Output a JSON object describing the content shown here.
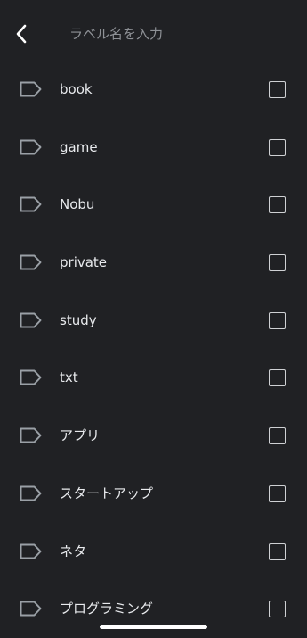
{
  "header": {
    "back_icon": "chevron-left-icon",
    "search_placeholder": "ラベル名を入力",
    "search_value": ""
  },
  "labels": [
    {
      "label": "book",
      "checked": false,
      "icon": "label-outline-icon"
    },
    {
      "label": "game",
      "checked": false,
      "icon": "label-outline-icon"
    },
    {
      "label": "Nobu",
      "checked": false,
      "icon": "label-outline-icon"
    },
    {
      "label": "private",
      "checked": false,
      "icon": "label-outline-icon"
    },
    {
      "label": "study",
      "checked": false,
      "icon": "label-outline-icon"
    },
    {
      "label": "txt",
      "checked": false,
      "icon": "label-outline-icon"
    },
    {
      "label": "アプリ",
      "checked": false,
      "icon": "label-outline-icon"
    },
    {
      "label": "スタートアップ",
      "checked": false,
      "icon": "label-outline-icon"
    },
    {
      "label": "ネタ",
      "checked": false,
      "icon": "label-outline-icon"
    },
    {
      "label": "プログラミング",
      "checked": false,
      "icon": "label-outline-icon"
    }
  ],
  "colors": {
    "background": "#202124",
    "text": "#e8eaed",
    "placeholder": "#8e9196",
    "icon": "#9aa0a6"
  }
}
